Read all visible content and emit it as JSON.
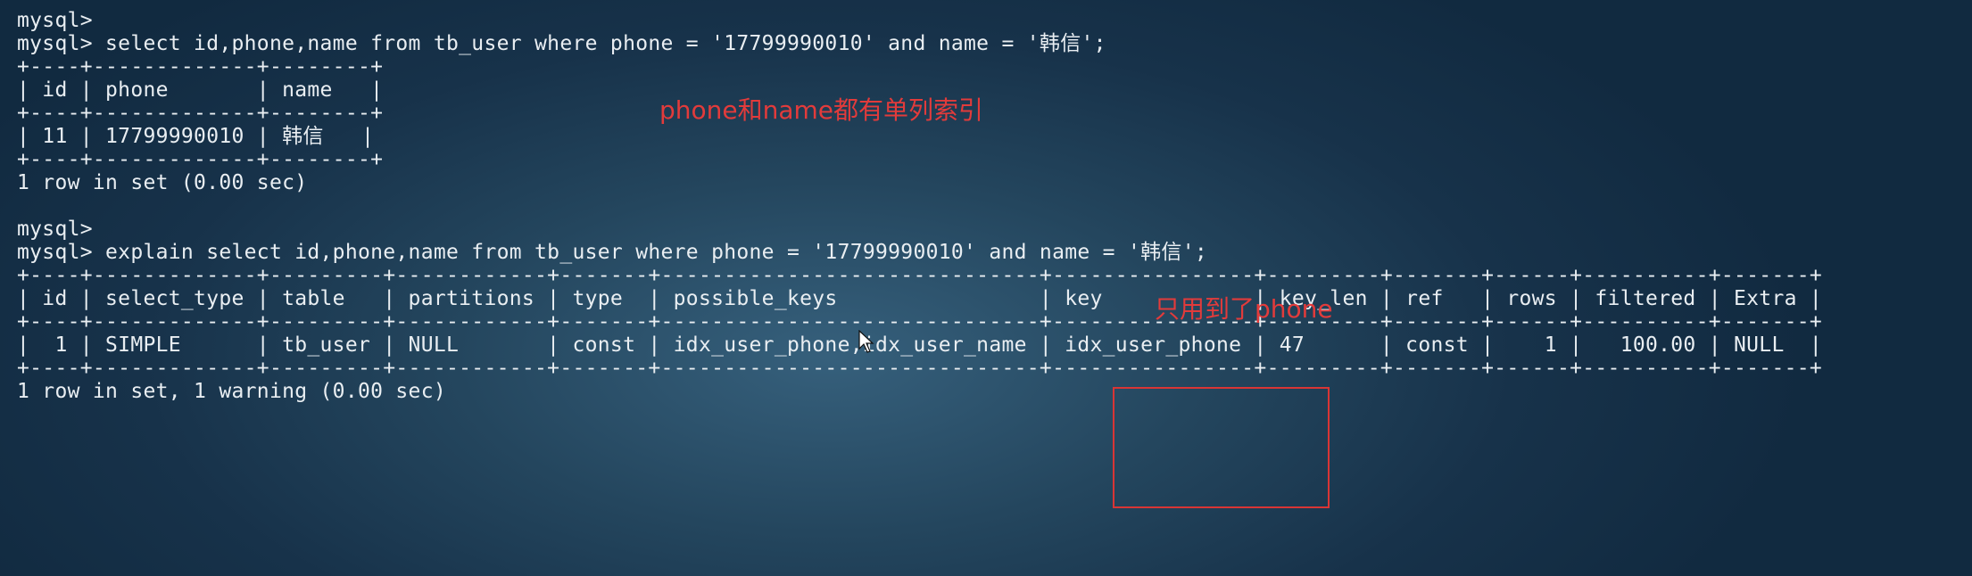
{
  "terminal": {
    "lines": [
      "mysql>",
      "mysql> select id,phone,name from tb_user where phone = '17799990010' and name = '韩信';",
      "+----+-------------+--------+",
      "| id | phone       | name   |",
      "+----+-------------+--------+",
      "| 11 | 17799990010 | 韩信   |",
      "+----+-------------+--------+",
      "1 row in set (0.00 sec)",
      "",
      "mysql>",
      "mysql> explain select id,phone,name from tb_user where phone = '17799990010' and name = '韩信';",
      "+----+-------------+---------+------------+-------+------------------------------+----------------+---------+-------+------+----------+-------+",
      "| id | select_type | table   | partitions | type  | possible_keys                | key            | key_len | ref   | rows | filtered | Extra |",
      "+----+-------------+---------+------------+-------+------------------------------+----------------+---------+-------+------+----------+-------+",
      "|  1 | SIMPLE      | tb_user | NULL       | const | idx_user_phone,idx_user_name | idx_user_phone | 47      | const |    1 |   100.00 | NULL  |",
      "+----+-------------+---------+------------+-------+------------------------------+----------------+---------+-------+------+----------+-------+",
      "1 row in set, 1 warning (0.00 sec)"
    ]
  },
  "annotations": {
    "note_index": "phone和name都有单列索引",
    "note_key": "只用到了phone"
  },
  "colors": {
    "annotation_red": "#e23b3b",
    "terminal_text": "#e9eef2"
  },
  "icons": {
    "cursor": "mouse-pointer-icon"
  }
}
